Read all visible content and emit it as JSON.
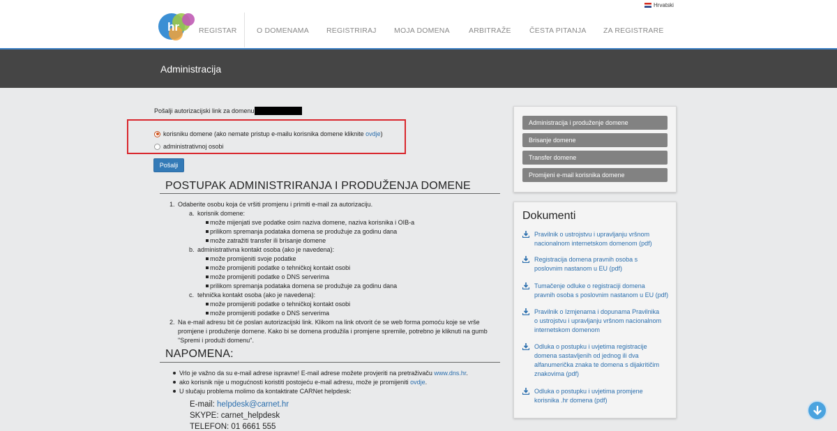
{
  "header": {
    "language": "Hrvatski",
    "logo_text": "hr",
    "nav": [
      "REGISTAR",
      "O DOMENAMA",
      "REGISTRIRAJ",
      "MOJA DOMENA",
      "ARBITRAŽE",
      "ČESTA PITANJA",
      "ZA REGISTRARE"
    ]
  },
  "banner": {
    "title": "Administracija"
  },
  "form": {
    "intro": "Pošalji autorizacijski link za domenu",
    "option1_text": "korisniku domene (ako nemate pristup e-mailu korisnika domene kliknite ",
    "option1_link": "ovdje",
    "option1_end": ")",
    "option2_text": "administrativnoj osobi",
    "submit_label": "Pošalji"
  },
  "procedure": {
    "title": "POSTUPAK ADMINISTRIRANJA I PRODUŽENJA DOMENE",
    "step1": "Odaberite osobu koja će vršiti promjenu i primiti e-mail za autorizaciju.",
    "a_label": "korisnik domene:",
    "a_items": [
      "može mijenjati sve podatke osim naziva domene, naziva korisnika i OIB-a",
      "prilikom spremanja podataka domena se produžuje za godinu dana",
      "može zatražiti transfer ili brisanje domene"
    ],
    "b_label": "administrativna kontakt osoba (ako je navedena):",
    "b_items": [
      "može promijeniti svoje podatke",
      "može promijeniti podatke o tehničkoj kontakt osobi",
      "može promijeniti podatke o DNS serverima",
      "prilikom spremanja podataka domena se produžuje za godinu dana"
    ],
    "c_label": "tehnička kontakt osoba (ako je navedena):",
    "c_items": [
      "može promijeniti podatke o tehničkoj kontakt osobi",
      "može promijeniti podatke o DNS serverima"
    ],
    "step2_line1": "Na e-mail adresu bit će poslan autorizacijski link. Klikom na link otvorit će se web forma pomoću koje se vrše",
    "step2_line2": "promjene i produženje domene. Kako bi se domena produžila i promjene spremile, potrebno je kliknuti na gumb",
    "step2_line3": "\"Spremi i produži domenu\"."
  },
  "note": {
    "title": "NAPOMENA:",
    "line1_text": "Vrlo je važno da su e-mail adrese ispravne! E-mail adrese možete provjeriti na pretraživaču ",
    "line1_link": "www.dns.hr",
    "line1_end": ".",
    "line2_text": "ako korisnik nije u mogućnosti koristiti postojeću e-mail adresu, može je promijeniti ",
    "line2_link": "ovdje",
    "line2_end": ".",
    "line3_text": "U slučaju problema molimo da kontaktirate CARNet helpdesk:",
    "email_label": "E-mail: ",
    "email": "helpdesk@carnet.hr",
    "skype": "SKYPE: carnet_helpdesk",
    "phone": "TELEFON: 01 6661 555"
  },
  "sidebar": {
    "buttons": [
      "Administracija i produženje domene",
      "Brisanje domene",
      "Transfer domene",
      "Promijeni e-mail korisnika domene"
    ],
    "docs_title": "Dokumenti",
    "docs": [
      [
        "Pravilnik o ustrojstvu i upravljanju vršnom",
        "nacionalnom internetskom domenom (pdf)"
      ],
      [
        "Registracija domena pravnih osoba s",
        "poslovnim nastanom u EU (pdf)"
      ],
      [
        "Tumačenje odluke o registraciji domena",
        "pravnih osoba s poslovnim nastanom u EU (pdf)"
      ],
      [
        "Pravilnik o Izmjenama i dopunama Pravilnika",
        "o ustrojstvu i upravljanju vršnom nacionalnom",
        "internetskom domenom"
      ],
      [
        "Odluka o postupku i uvjetima registracije",
        "domena sastavljenih od jednog ili dva",
        "alfanumerička znaka te domena s dijakritičim",
        "znakovima (pdf)"
      ],
      [
        "Odluka o postupku i uvjetima promjene",
        "korisnika .hr domena (pdf)"
      ]
    ]
  },
  "colors": {
    "accent": "#337ab7",
    "banner": "#454545",
    "highlight": "#d9262c"
  }
}
